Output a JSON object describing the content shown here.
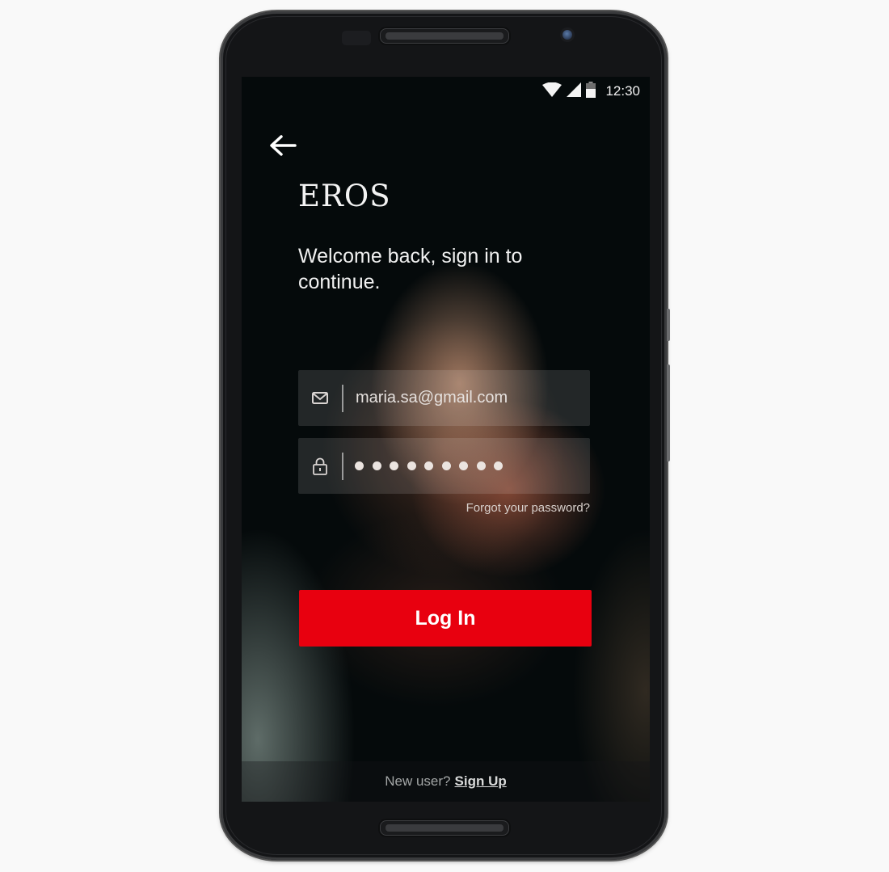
{
  "status_bar": {
    "time": "12:30",
    "icons": [
      "wifi-icon",
      "signal-icon",
      "battery-icon"
    ]
  },
  "header": {
    "back_icon": "arrow-left-icon",
    "brand": "EROS",
    "welcome": "Welcome back, sign in to continue."
  },
  "form": {
    "email": {
      "icon": "envelope-icon",
      "value": "maria.sa@gmail.com"
    },
    "password": {
      "icon": "lock-icon",
      "masked_length": 9
    },
    "forgot_label": "Forgot your password?",
    "login_label": "Log In"
  },
  "footer": {
    "prompt": "New user?",
    "signup_label": "Sign Up"
  },
  "colors": {
    "accent": "#e8000f",
    "background": "#050a0b",
    "text": "#f1f1f1"
  }
}
